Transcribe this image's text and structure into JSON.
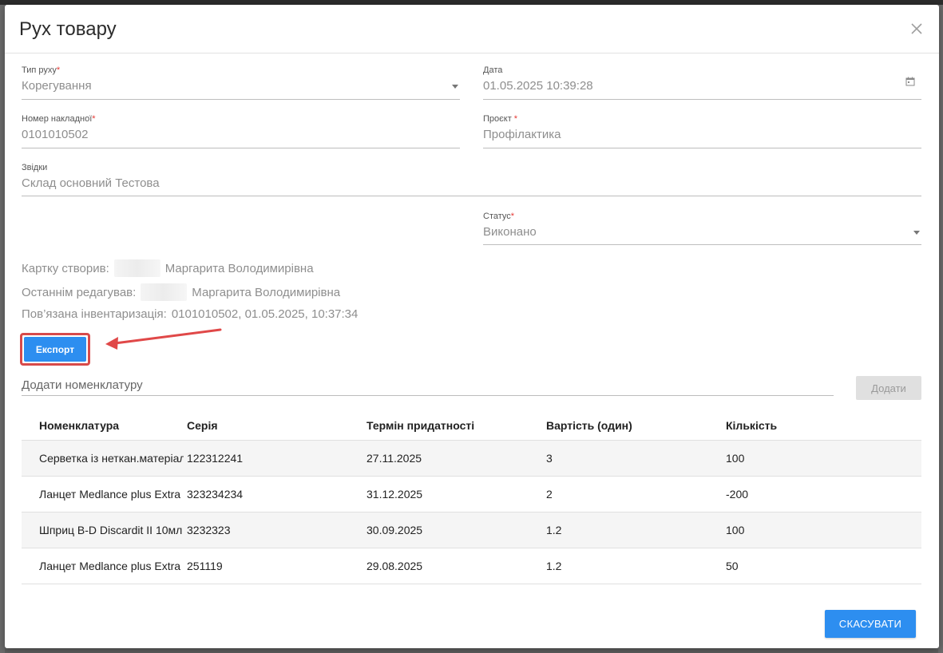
{
  "modal": {
    "title": "Рух товару"
  },
  "form": {
    "movement_type": {
      "label": "Тип руху",
      "required_mark": "*",
      "value": "Корегування"
    },
    "date": {
      "label": "Дата",
      "value": "01.05.2025 10:39:28"
    },
    "invoice_number": {
      "label": "Номер накладної",
      "required_mark": "*",
      "value": "0101010502"
    },
    "project": {
      "label": "Проєкт ",
      "required_mark": "*",
      "value": "Профілактика"
    },
    "from": {
      "label": "Звідки",
      "value": "Склад основний Тестова"
    },
    "status": {
      "label": "Статус",
      "required_mark": "*",
      "value": "Виконано"
    }
  },
  "info": {
    "created_by_label": "Картку створив:",
    "created_by_name": "Маргарита Володимирівна",
    "edited_by_label": "Останнім редагував:",
    "edited_by_name": "Маргарита Володимирівна",
    "inventory_label": "Пов’язана інвентаризація:",
    "inventory_value": "0101010502, 01.05.2025, 10:37:34"
  },
  "export_label": "Експорт",
  "add_nomenclature": {
    "placeholder": "Додати номенклатуру",
    "button_label": "Додати"
  },
  "table": {
    "headers": [
      "Номенклатура",
      "Серія",
      "Термін придатності",
      "Вартість (один)",
      "Кількість"
    ],
    "rows": [
      [
        "Серветка із неткан.матеріалу",
        "122312241",
        "27.11.2025",
        "3",
        "100"
      ],
      [
        "Ланцет Medlance plus Extra",
        "323234234",
        "31.12.2025",
        "2",
        "-200"
      ],
      [
        "Шприц B-D Discardit II 10мл",
        "3232323",
        "30.09.2025",
        "1.2",
        "100"
      ],
      [
        "Ланцет Medlance plus Extra",
        "251119",
        "29.08.2025",
        "1.2",
        "50"
      ]
    ]
  },
  "cancel_label": "СКАСУВАТИ",
  "colors": {
    "accent": "#2d8ef0",
    "highlight": "#d84a4a",
    "required": "#e53935"
  }
}
